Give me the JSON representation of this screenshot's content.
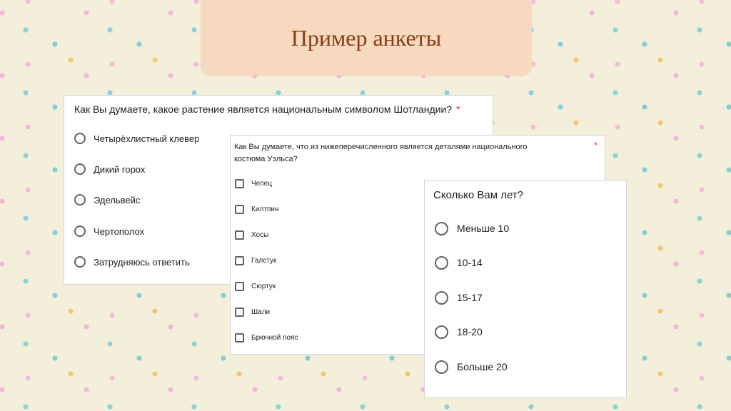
{
  "slide": {
    "title": "Пример анкеты"
  },
  "question1": {
    "text": "Как Вы думаете, какое растение является национальным символом Шотландии?",
    "required_mark": "*",
    "options": [
      "Четырёхлистный клевер",
      "Дикий горох",
      "Эдельвейс",
      "Чертополох",
      "Затрудняюсь ответить"
    ]
  },
  "question2": {
    "text": "Как Вы думаете, что из нижеперечисленного является деталями национального костюма Уэльса?",
    "required_mark": "*",
    "options": [
      "Чепец",
      "Килтпин",
      "Хосы",
      "Галстук",
      "Сюртук",
      "Шали",
      "Брючной пояс"
    ]
  },
  "question3": {
    "text": "Сколько Вам лет?",
    "options": [
      "Меньше 10",
      "10-14",
      "15-17",
      "18-20",
      "Больше 20"
    ]
  },
  "colors": {
    "title": "#8a3b13",
    "banner": "#f6d9bf",
    "required": "#d93025"
  }
}
